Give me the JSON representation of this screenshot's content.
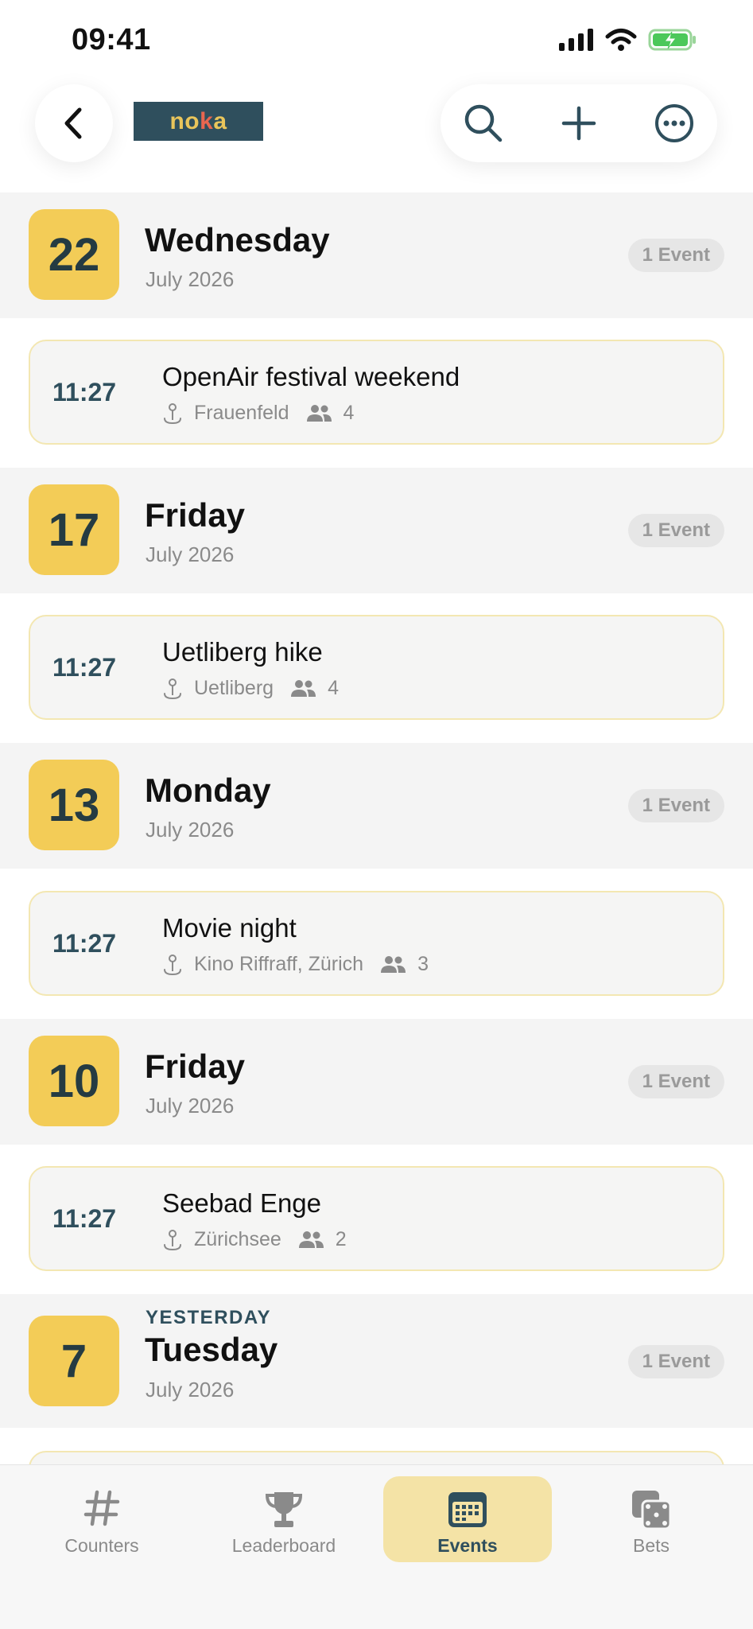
{
  "status": {
    "time": "09:41"
  },
  "header": {
    "logo_pre": "no",
    "logo_k": "k",
    "logo_post": "a"
  },
  "days": [
    {
      "number": "22",
      "weekday": "Wednesday",
      "month": "July 2026",
      "tag": "",
      "event_count": "1 Event",
      "events": [
        {
          "time": "11:27",
          "title": "OpenAir festival weekend",
          "location": "Frauenfeld",
          "attendees": "4"
        }
      ]
    },
    {
      "number": "17",
      "weekday": "Friday",
      "month": "July 2026",
      "tag": "",
      "event_count": "1 Event",
      "events": [
        {
          "time": "11:27",
          "title": "Uetliberg hike",
          "location": "Uetliberg",
          "attendees": "4"
        }
      ]
    },
    {
      "number": "13",
      "weekday": "Monday",
      "month": "July 2026",
      "tag": "",
      "event_count": "1 Event",
      "events": [
        {
          "time": "11:27",
          "title": "Movie night",
          "location": "Kino Riffraff, Zürich",
          "attendees": "3"
        }
      ]
    },
    {
      "number": "10",
      "weekday": "Friday",
      "month": "July 2026",
      "tag": "",
      "event_count": "1 Event",
      "events": [
        {
          "time": "11:27",
          "title": "Seebad Enge",
          "location": "Zürichsee",
          "attendees": "2"
        }
      ]
    },
    {
      "number": "7",
      "weekday": "Tuesday",
      "month": "July 2026",
      "tag": "YESTERDAY",
      "event_count": "1 Event",
      "events": []
    }
  ],
  "tabs": [
    {
      "label": "Counters",
      "icon": "hash-icon",
      "active": false
    },
    {
      "label": "Leaderboard",
      "icon": "trophy-icon",
      "active": false
    },
    {
      "label": "Events",
      "icon": "calendar-icon",
      "active": true
    },
    {
      "label": "Bets",
      "icon": "dice-icon",
      "active": false
    }
  ],
  "colors": {
    "accent": "#f3cc57",
    "primary": "#2f4f5d",
    "active_tab": "#f4e3a6",
    "header_bg": "#f4f4f4"
  }
}
